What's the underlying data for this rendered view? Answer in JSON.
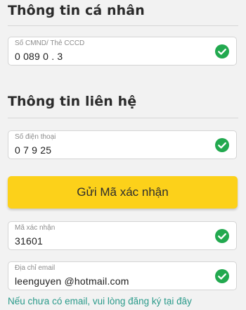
{
  "personal_info": {
    "title": "Thông tin cá nhân",
    "id_field": {
      "label": "Số CMND/ Thẻ CCCD",
      "value": "0  089 0 . 3   ",
      "validated": true
    }
  },
  "contact_info": {
    "title": "Thông tin liên hệ",
    "phone_field": {
      "label": "Số điện thoại",
      "value": "0  7      9 25",
      "validated": true
    }
  },
  "submit_button": {
    "label": "Gửi Mã xác nhận"
  },
  "code_field": {
    "label": "Mã xác nhận",
    "value": "31601",
    "validated": true
  },
  "email_field": {
    "label": "Địa chỉ email",
    "value": "leenguyen    @hotmail.com",
    "validated": true
  },
  "footer": {
    "register_link": "Nếu chưa có email, vui lòng đăng ký tại đây"
  },
  "colors": {
    "accent_yellow": "#fcd11a",
    "check_green": "#22a94f",
    "link_teal": "#2a9a8a"
  },
  "icons": {
    "validated": "check-circle-icon"
  }
}
